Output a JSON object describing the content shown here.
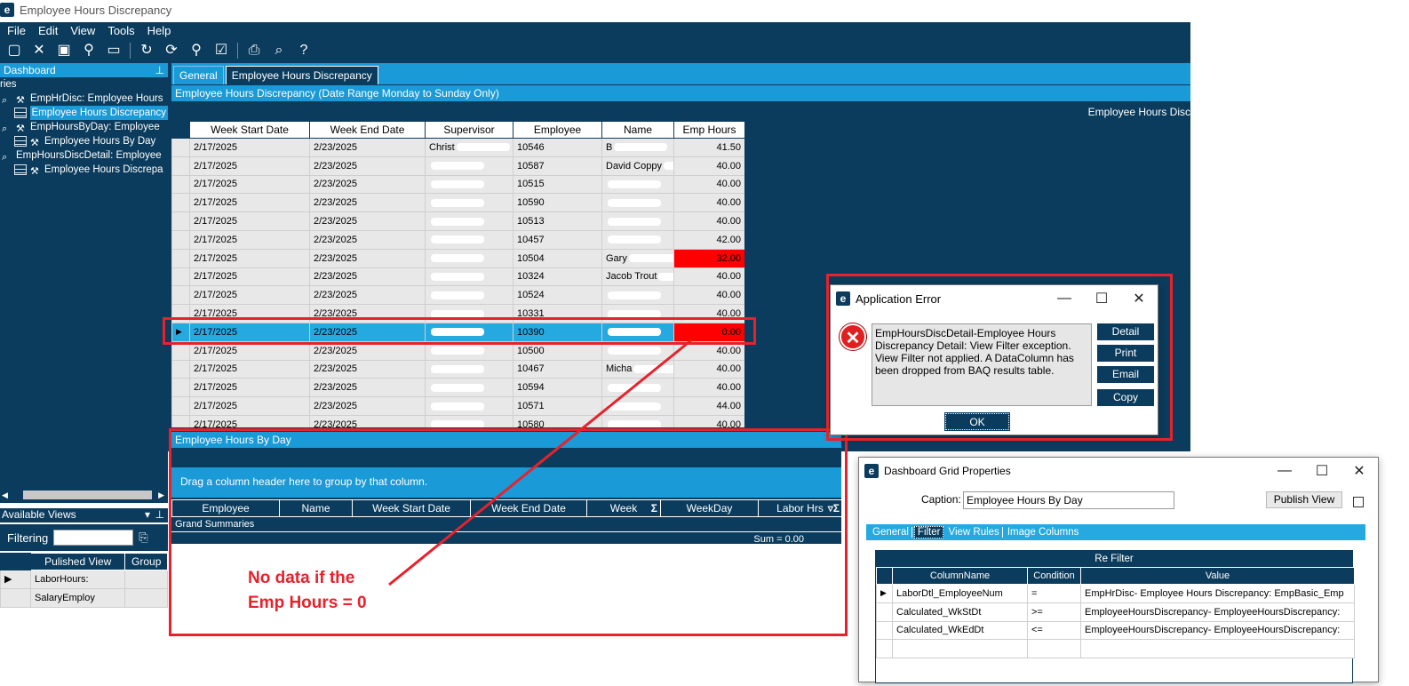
{
  "window": {
    "title": "Employee Hours Discrepancy",
    "logo": "e"
  },
  "menu": [
    "File",
    "Edit",
    "View",
    "Tools",
    "Help"
  ],
  "toolbar_icons": [
    "new-icon",
    "delete-icon",
    "save-icon",
    "clear-icon",
    "notes-icon",
    "refresh-icon",
    "refresh-all-icon",
    "clean-icon",
    "attach-icon",
    "print-icon",
    "preview-icon",
    "help-icon"
  ],
  "sidebar": {
    "header": "Dashboard",
    "section": "ries",
    "items": [
      "EmpHrDisc: Employee Hours",
      "Employee Hours Discrepancy",
      "EmpHoursByDay: Employee",
      "Employee Hours By Day",
      "EmpHoursDiscDetail: Employee",
      "Employee Hours Discrepa"
    ]
  },
  "available_views": {
    "header": "Available Views",
    "filter_label": "Filtering",
    "columns": [
      "Pulished View",
      "Group"
    ],
    "rows": [
      [
        "LaborHours:",
        ""
      ],
      [
        "SalaryEmploy",
        ""
      ]
    ]
  },
  "tabs": [
    "General",
    "Employee Hours Discrepancy"
  ],
  "main": {
    "section_title": "Employee Hours Discrepancy (Date Range Monday to Sunday Only)",
    "subheader": "Employee Hours Disc",
    "columns": [
      "Week Start Date",
      "Week End Date",
      "Supervisor",
      "Employee",
      "Name",
      "Emp Hours"
    ],
    "rows": [
      {
        "ws": "2/17/2025",
        "we": "2/23/2025",
        "sup": "Christ",
        "emp": "10546",
        "name": "B",
        "hours": "41.50"
      },
      {
        "ws": "2/17/2025",
        "we": "2/23/2025",
        "sup": "",
        "emp": "10587",
        "name": "David Coppy",
        "hours": "40.00"
      },
      {
        "ws": "2/17/2025",
        "we": "2/23/2025",
        "sup": "",
        "emp": "10515",
        "name": "",
        "hours": "40.00"
      },
      {
        "ws": "2/17/2025",
        "we": "2/23/2025",
        "sup": "",
        "emp": "10590",
        "name": "",
        "hours": "40.00"
      },
      {
        "ws": "2/17/2025",
        "we": "2/23/2025",
        "sup": "",
        "emp": "10513",
        "name": "",
        "hours": "40.00"
      },
      {
        "ws": "2/17/2025",
        "we": "2/23/2025",
        "sup": "",
        "emp": "10457",
        "name": "",
        "hours": "42.00"
      },
      {
        "ws": "2/17/2025",
        "we": "2/23/2025",
        "sup": "",
        "emp": "10504",
        "name": "Gary",
        "hours": "32.00",
        "flag": true
      },
      {
        "ws": "2/17/2025",
        "we": "2/23/2025",
        "sup": "",
        "emp": "10324",
        "name": "Jacob Trout",
        "hours": "40.00"
      },
      {
        "ws": "2/17/2025",
        "we": "2/23/2025",
        "sup": "",
        "emp": "10524",
        "name": "",
        "hours": "40.00"
      },
      {
        "ws": "2/17/2025",
        "we": "2/23/2025",
        "sup": "",
        "emp": "10331",
        "name": "",
        "hours": "40.00"
      },
      {
        "ws": "2/17/2025",
        "we": "2/23/2025",
        "sup": "",
        "emp": "10390",
        "name": "",
        "hours": "0.00",
        "flag": true,
        "selected": true
      },
      {
        "ws": "2/17/2025",
        "we": "2/23/2025",
        "sup": "",
        "emp": "10500",
        "name": "",
        "hours": "40.00"
      },
      {
        "ws": "2/17/2025",
        "we": "2/23/2025",
        "sup": "",
        "emp": "10467",
        "name": "Micha",
        "hours": "40.00"
      },
      {
        "ws": "2/17/2025",
        "we": "2/23/2025",
        "sup": "",
        "emp": "10594",
        "name": "",
        "hours": "40.00"
      },
      {
        "ws": "2/17/2025",
        "we": "2/23/2025",
        "sup": "",
        "emp": "10571",
        "name": "",
        "hours": "44.00"
      },
      {
        "ws": "2/17/2025",
        "we": "2/23/2025",
        "sup": "",
        "emp": "10580",
        "name": "",
        "hours": "40.00"
      }
    ]
  },
  "byday": {
    "title": "Employee Hours By Day",
    "group_hint": "Drag a column header here to group by that column.",
    "columns": [
      "Employee",
      "Name",
      "Week Start Date",
      "Week End Date",
      "Week",
      "WeekDay",
      "Labor Hrs"
    ],
    "summaries_label": "Grand Summaries",
    "sum": "Sum = 0.00"
  },
  "annotation": {
    "line1": "No data if the",
    "line2": "Emp Hours = 0"
  },
  "error_dialog": {
    "title": "Application Error",
    "message": "EmpHoursDiscDetail-Employee Hours Discrepancy Detail: View Filter exception. View Filter not applied.  A DataColumn has been dropped from BAQ results table.",
    "buttons": [
      "Detail",
      "Print",
      "Email",
      "Copy"
    ],
    "ok": "OK"
  },
  "grid_props": {
    "title": "Dashboard Grid Properties",
    "caption_label": "Caption:",
    "caption_value": "Employee Hours By Day",
    "publish": "Publish View",
    "tabs": [
      "General",
      "Filter",
      "View Rules",
      "Image Columns"
    ],
    "refilter_header": "Re Filter",
    "columns": [
      "ColumnName",
      "Condition",
      "Value"
    ],
    "rows": [
      [
        "LaborDtl_EmployeeNum",
        "=",
        "EmpHrDisc- Employee Hours Discrepancy: EmpBasic_Emp"
      ],
      [
        "Calculated_WkStDt",
        ">=",
        "EmployeeHoursDiscrepancy- EmployeeHoursDiscrepancy:"
      ],
      [
        "Calculated_WkEdDt",
        "<=",
        "EmployeeHoursDiscrepancy- EmployeeHoursDiscrepancy:"
      ]
    ]
  },
  "colors": {
    "navy": "#0b3c5d",
    "blue": "#1a9ad6",
    "highlight": "#26a9e1",
    "alert": "#ff0000",
    "annotation": "#e8212b"
  }
}
